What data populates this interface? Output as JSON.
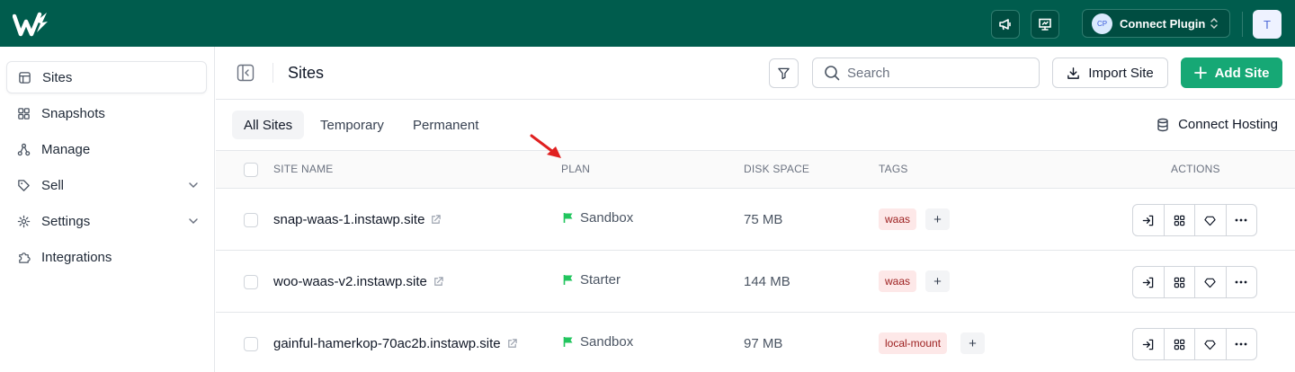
{
  "topbar": {
    "connect_plugin_label": "Connect Plugin",
    "connect_plugin_avatar": "CP",
    "user_initial": "T",
    "icons": [
      "megaphone-icon",
      "presentation-icon",
      "chevron-updown-icon"
    ]
  },
  "sidebar": {
    "items": [
      {
        "label": "Sites",
        "icon": "layout-icon",
        "active": true
      },
      {
        "label": "Snapshots",
        "icon": "grid-icon"
      },
      {
        "label": "Manage",
        "icon": "hierarchy-icon"
      },
      {
        "label": "Sell",
        "icon": "tag-icon",
        "expandable": true
      },
      {
        "label": "Settings",
        "icon": "gear-icon",
        "expandable": true
      },
      {
        "label": "Integrations",
        "icon": "puzzle-icon"
      }
    ]
  },
  "header": {
    "title": "Sites",
    "search_placeholder": "Search",
    "import_label": "Import Site",
    "add_label": "Add Site"
  },
  "tabs": {
    "items": [
      "All Sites",
      "Temporary",
      "Permanent"
    ],
    "active": "All Sites",
    "connect_hosting": "Connect Hosting"
  },
  "table": {
    "headers": {
      "site_name": "SITE NAME",
      "plan": "PLAN",
      "disk_space": "DISK SPACE",
      "tags": "TAGS",
      "actions": "ACTIONS"
    },
    "rows": [
      {
        "site": "snap-waas-1.instawp.site",
        "plan": "Sandbox",
        "disk": "75 MB",
        "tag": "waas"
      },
      {
        "site": "woo-waas-v2.instawp.site",
        "plan": "Starter",
        "disk": "144 MB",
        "tag": "waas"
      },
      {
        "site": "gainful-hamerkop-70ac2b.instawp.site",
        "plan": "Sandbox",
        "disk": "97 MB",
        "tag": "local-mount"
      }
    ],
    "tag_add": "+"
  },
  "colors": {
    "topbar": "#005c4d",
    "primary_button": "#16a875",
    "plan_flag": "#22c55e",
    "tag_bg": "#fde8e8",
    "tag_text": "#9b1c1c",
    "annotation_arrow": "#e02020"
  }
}
